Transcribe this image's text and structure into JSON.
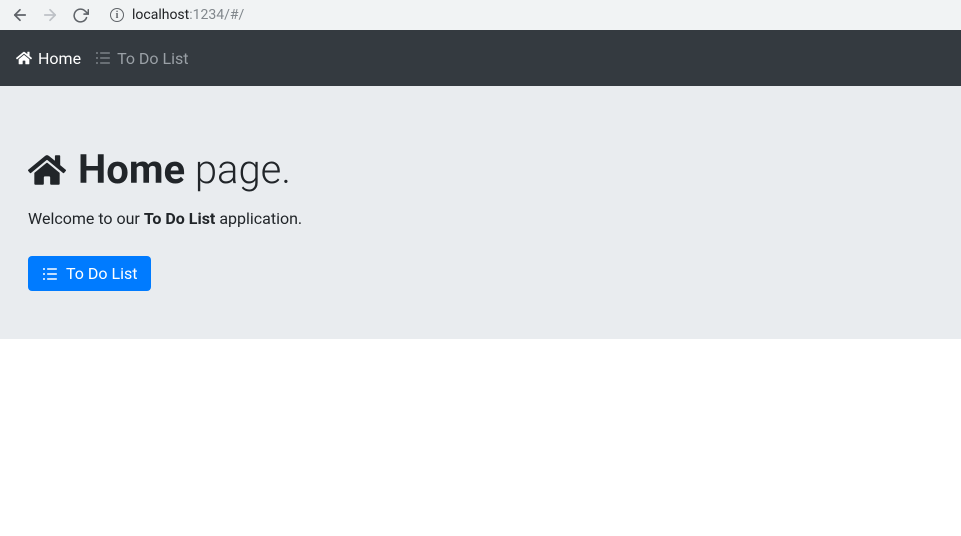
{
  "browser": {
    "url_host": "localhost",
    "url_path": ":1234/#/"
  },
  "nav": {
    "home_label": "Home",
    "todo_label": "To Do List"
  },
  "main": {
    "title_bold": "Home",
    "title_rest": " page.",
    "welcome_pre": "Welcome to our ",
    "welcome_bold": "To Do List",
    "welcome_post": " application.",
    "button_label": "To Do List"
  }
}
